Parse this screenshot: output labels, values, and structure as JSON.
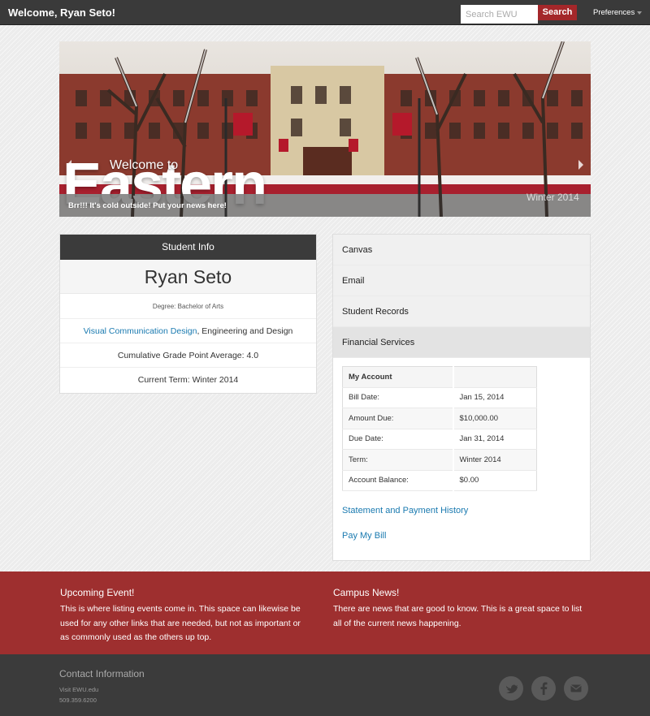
{
  "topbar": {
    "welcome": "Welcome, Ryan Seto!",
    "search_placeholder": "Search EWU",
    "search_button": "Search",
    "preferences": "Preferences"
  },
  "hero": {
    "welcome_to": "Welcome to",
    "eastern": "Eastern",
    "news": "Brr!!! It's cold outside! Put your news here!",
    "term": "Winter 2014",
    "carousel_icons": [
      "arrow-left-icon",
      "arrow-right-icon"
    ]
  },
  "student_info": {
    "header": "Student Info",
    "name": "Ryan Seto",
    "degree": "Degree: Bachelor of Arts",
    "major_link": "Visual Communication Design",
    "major_rest": ", Engineering and Design",
    "gpa": "Cumulative Grade Point Average: 4.0",
    "term": "Current Term: Winter 2014"
  },
  "quick_links": {
    "items": [
      "Canvas",
      "Email",
      "Student Records",
      "Financial Services"
    ]
  },
  "account": {
    "title": "My Account",
    "rows": [
      {
        "label": "Bill Date:",
        "value": "Jan 15, 2014"
      },
      {
        "label": "Amount Due:",
        "value": "$10,000.00"
      },
      {
        "label": "Due Date:",
        "value": "Jan 31, 2014"
      },
      {
        "label": "Term:",
        "value": "Winter 2014"
      },
      {
        "label": "Account Balance:",
        "value": "$0.00"
      }
    ],
    "statement_link": "Statement and Payment History",
    "pay_link": "Pay My Bill"
  },
  "events": {
    "title": "Upcoming Event!",
    "lines": [
      "This is where listing events come in. This space can likewise be",
      "used for any other links that are needed, but not as important or",
      "as commonly used as the others up top."
    ]
  },
  "news": {
    "title": "Campus News!",
    "lines": [
      "There are news that are good to know. This is a great space to list",
      "all of the current news happening."
    ]
  },
  "footer": {
    "contact_title": "Contact Information",
    "site": "Visit EWU.edu",
    "phone": "509.359.6200",
    "social_icons": [
      "twitter-icon",
      "facebook-icon",
      "mail-icon"
    ]
  },
  "colors": {
    "brand_red": "#a4272a",
    "band_red": "#9e2f2f",
    "dark_bar": "#3a3a3a",
    "link_blue": "#1a7ab0"
  }
}
